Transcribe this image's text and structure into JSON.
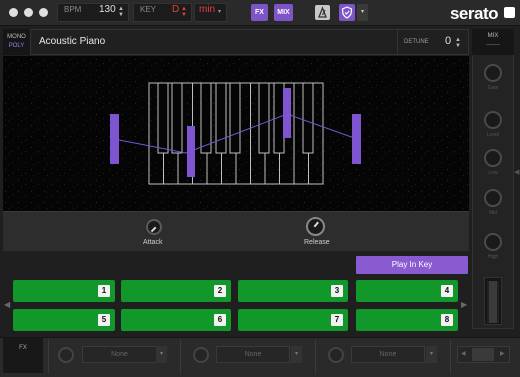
{
  "toolbar": {
    "bpm_label": "BPM",
    "bpm_value": "130",
    "key_label": "KEY",
    "key_value": "D",
    "scale_value": "min",
    "fx_button": "FX",
    "mix_button": "MIX",
    "brand": "serato"
  },
  "instrument": {
    "mono_label": "MONO",
    "poly_label": "POLY",
    "name": "Acoustic Piano",
    "detune_label": "DETUNE",
    "detune_value": "0"
  },
  "envelope": {
    "attack_label": "Attack",
    "release_label": "Release"
  },
  "play_in_key_label": "Play In Key",
  "pads": [
    {
      "label": "1"
    },
    {
      "label": "2"
    },
    {
      "label": "3"
    },
    {
      "label": "4"
    },
    {
      "label": "5"
    },
    {
      "label": "6"
    },
    {
      "label": "7"
    },
    {
      "label": "8"
    }
  ],
  "mix": {
    "title": "MIX",
    "knob_labels": [
      "Gain",
      "Level",
      "Low",
      "Mid",
      "High"
    ]
  },
  "fx": {
    "label": "FX",
    "slots": [
      {
        "value": "None"
      },
      {
        "value": "None"
      },
      {
        "value": "None"
      }
    ]
  },
  "colors": {
    "accent_purple": "#8a5ad0",
    "pad_green": "#12972a",
    "key_red": "#e04040"
  }
}
